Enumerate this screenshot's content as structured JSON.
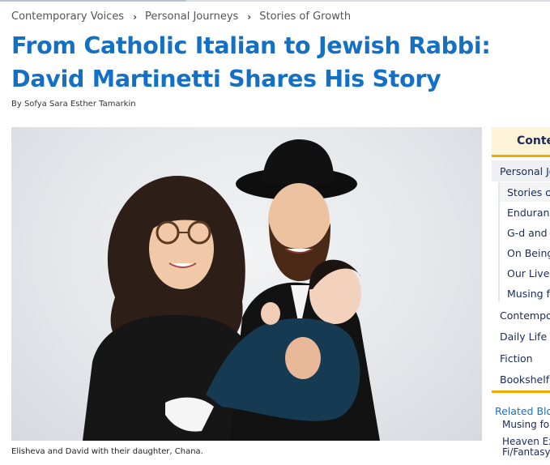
{
  "breadcrumb": [
    "Contemporary Voices",
    "Personal Journeys",
    "Stories of Growth"
  ],
  "article": {
    "title": "From Catholic Italian to Jewish Rabbi: David Martinetti Shares His Story",
    "byline": "By Sofya Sara Esther Tamarkin",
    "caption": "Elisheva and David with their daughter, Chana."
  },
  "sidebar": {
    "contents_heading": "Conte",
    "items": [
      {
        "label": "Personal Jo"
      },
      {
        "label": "Stories of"
      },
      {
        "label": "Enduranc"
      },
      {
        "label": "G-d and U"
      },
      {
        "label": "On Being"
      },
      {
        "label": "Our Lives"
      },
      {
        "label": "Musing fo"
      },
      {
        "label": "Contempor"
      },
      {
        "label": "Daily Life"
      },
      {
        "label": "Fiction"
      },
      {
        "label": "Bookshelf"
      }
    ],
    "related": {
      "heading": "Related Blog",
      "links": [
        "Musing for",
        "Heaven Ex\nFi/Fantasy"
      ]
    }
  },
  "colors": {
    "title": "#1470c4",
    "accent": "#f2a900",
    "nav": "#1a2b5b"
  }
}
